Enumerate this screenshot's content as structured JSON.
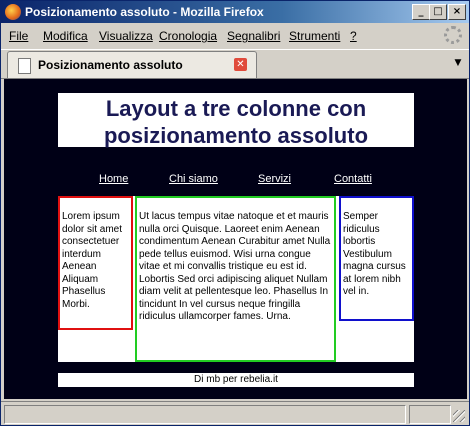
{
  "window": {
    "title": "Posizionamento assoluto - Mozilla Firefox",
    "controls": {
      "minimize": "_",
      "maximize": "□",
      "close": "×"
    }
  },
  "menu": {
    "items": [
      {
        "label": "File"
      },
      {
        "label": "Modifica"
      },
      {
        "label": "Visualizza"
      },
      {
        "label": "Cronologia"
      },
      {
        "label": "Segnalibri"
      },
      {
        "label": "Strumenti"
      },
      {
        "label": "?"
      }
    ]
  },
  "tabs": [
    {
      "label": "Posizionamento assoluto",
      "active": true
    }
  ],
  "page": {
    "header": "Layout a tre colonne con posizionamento assoluto",
    "nav": [
      {
        "label": "Home"
      },
      {
        "label": "Chi siamo"
      },
      {
        "label": "Servizi"
      },
      {
        "label": "Contatti"
      }
    ],
    "columns": {
      "left": "Lorem ipsum dolor sit amet consectetuer interdum Aenean Aliquam Phasellus Morbi.",
      "center": "Ut lacus tempus vitae natoque et et mauris nulla orci Quisque. Laoreet enim Aenean condimentum Aenean Curabitur amet Nulla pede tellus euismod. Wisi urna congue vitae et mi convallis tristique eu est id. Lobortis Sed orci adipiscing aliquet Nullam diam velit at pellentesque leo. Phasellus In tincidunt In vel cursus neque fringilla ridiculus ullamcorper fames. Urna.",
      "right": "Semper ridiculus lobortis Vestibulum magna cursus at lorem nibh vel in."
    },
    "footer": "Di mb per rebelia.it"
  },
  "colors": {
    "page_background": "#000016",
    "left_border": "#e01010",
    "center_border": "#22cc22",
    "right_border": "#1010cc",
    "header_text": "#1a1a55"
  }
}
